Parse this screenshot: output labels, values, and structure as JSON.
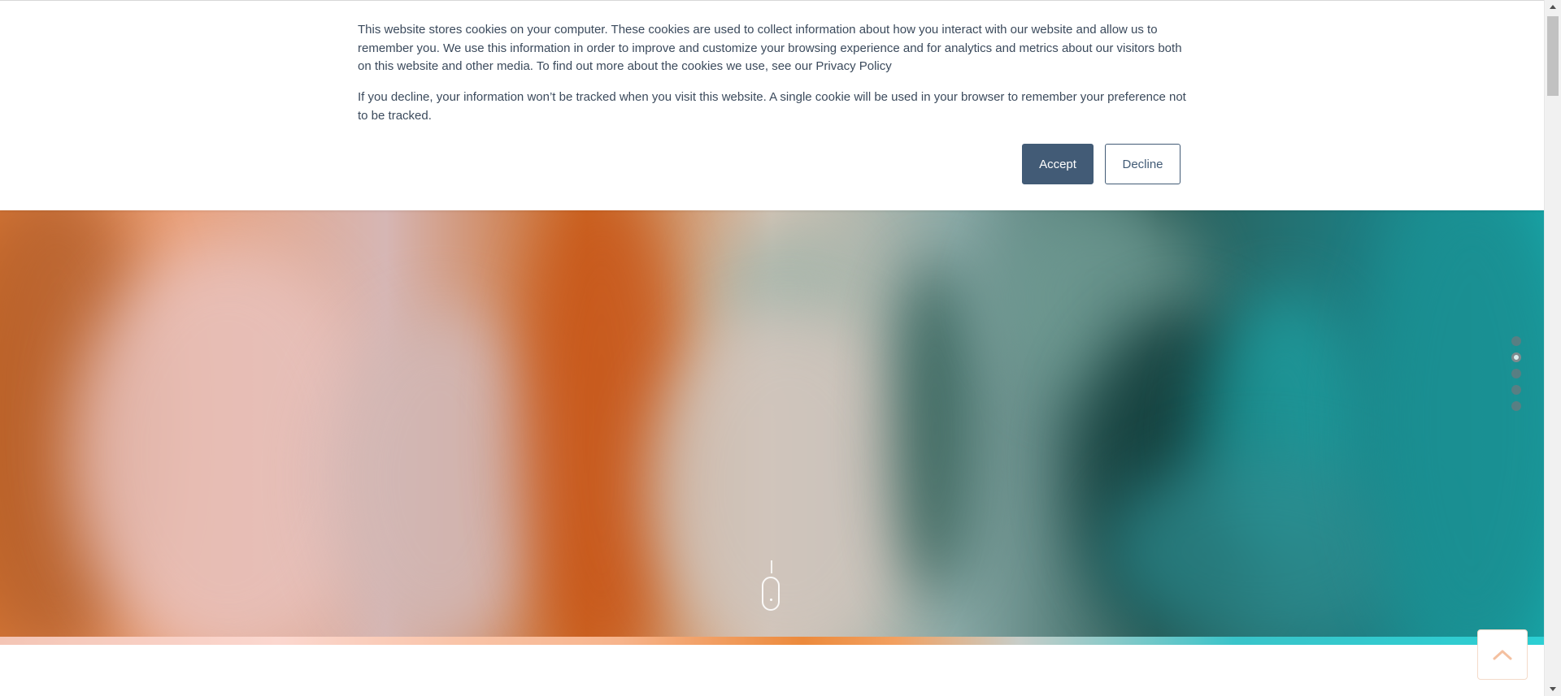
{
  "cookie_banner": {
    "paragraph_1": "This website stores cookies on your computer. These cookies are used to collect information about how you interact with our website and allow us to remember you. We use this information in order to improve and customize your browsing experience and for analytics and metrics about our visitors both on this website and other media. To find out more about the cookies we use, see our Privacy Policy",
    "paragraph_2": "If you decline, your information won’t be tracked when you visit this website. A single cookie will be used in your browser to remember your preference not to be tracked.",
    "accept_label": "Accept",
    "decline_label": "Decline"
  },
  "slider": {
    "total_slides": 5,
    "active_slide_index": 1
  },
  "icons": {
    "scroll": "mouse-scroll-icon",
    "back_to_top": "chevron-up-icon",
    "scroll_up": "triangle-up-icon",
    "scroll_down": "triangle-down-icon"
  },
  "colors": {
    "button_primary": "#425b76",
    "text": "#3b4a5c",
    "back_to_top_icon": "#f4c0a0"
  }
}
